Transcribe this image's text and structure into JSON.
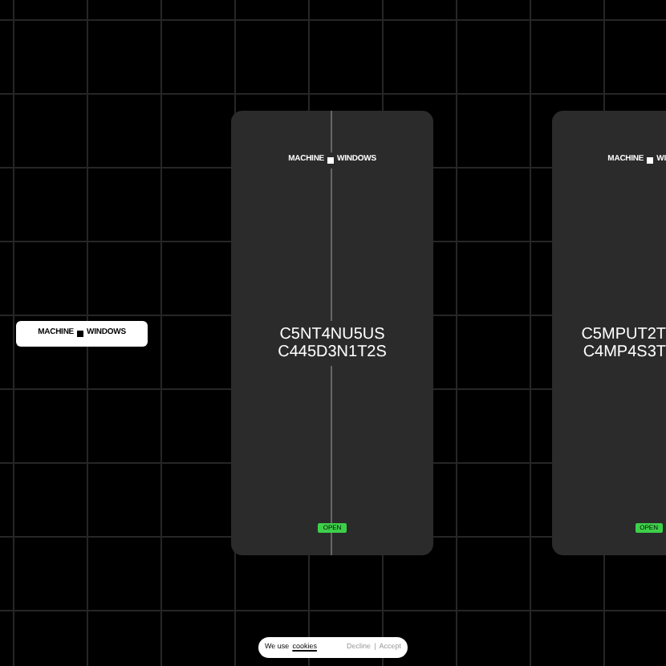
{
  "logo_button": {
    "left": "MACHINE",
    "right": "WINDOWS"
  },
  "cards": [
    {
      "brand_left": "MACHINE",
      "brand_right": "WINDOWS",
      "title_lines": [
        "C5NT4NU5US",
        "C445D3N1T2S"
      ],
      "badge": "OPEN"
    },
    {
      "brand_left": "MACHINE",
      "brand_right": "WI",
      "title_lines": [
        "C5MPUT2T",
        "C4MP4S3T"
      ],
      "badge": "OPEN"
    }
  ],
  "cookie_bar": {
    "text": "We use",
    "link": "cookies",
    "decline": "Decline",
    "separator": "|",
    "accept": "Accept"
  }
}
